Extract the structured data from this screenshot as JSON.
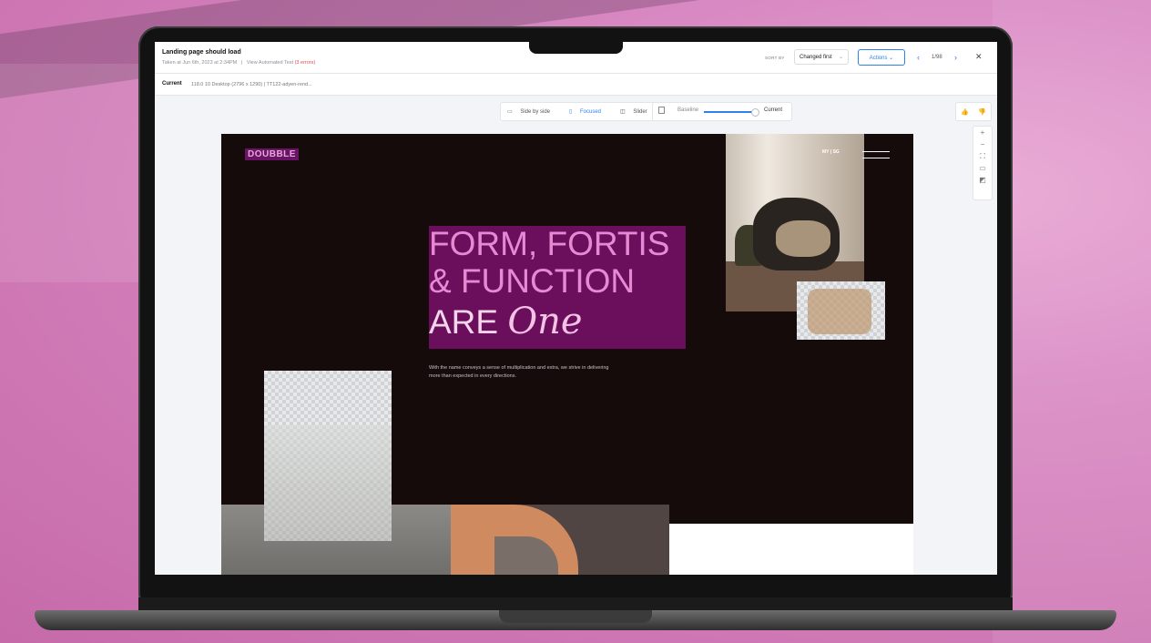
{
  "header": {
    "title": "Landing page should load",
    "taken": "Taken at Jun 6th, 2023 at 2:34PM",
    "separator": "|",
    "view_test": "View Automated Test",
    "errors": "(3 errors)",
    "sort_by_label": "SORT BY",
    "sort_value": "Changed first",
    "actions_label": "Actions",
    "counter": "1/98"
  },
  "subheader": {
    "current_label": "Current",
    "env_info": "118.0  10  Desktop (2796 x 1290)  |  TT122-adyen-rend..."
  },
  "toolbar": {
    "side_by_side": "Side by side",
    "focused": "Focused",
    "slider": "Slider",
    "baseline": "Baseline",
    "current": "Current",
    "slider_position": 0.95
  },
  "site": {
    "logo": "DOUBBLE",
    "menu": "MY | SG",
    "hero_line1": "FORM, FORTIS",
    "hero_line2": "& FUNCTION",
    "hero_line3": "ARE",
    "hero_script": "One",
    "description": "With the name conveys a sense of multiplication and extra, we strive in delivering more than expected in every directions."
  },
  "colors": {
    "accent": "#2f80ed",
    "error": "#e5484d",
    "hero_bg": "#6b0f5d",
    "hero_text": "#e58ad2",
    "site_bg": "#140b0a"
  },
  "icons": {
    "thumbs_up": "thumbs-up-icon",
    "thumbs_down": "thumbs-down-icon",
    "zoom_in": "plus-icon",
    "zoom_out": "minus-icon",
    "fit": "fit-icon",
    "folder": "folder-icon",
    "compare": "compare-icon"
  }
}
